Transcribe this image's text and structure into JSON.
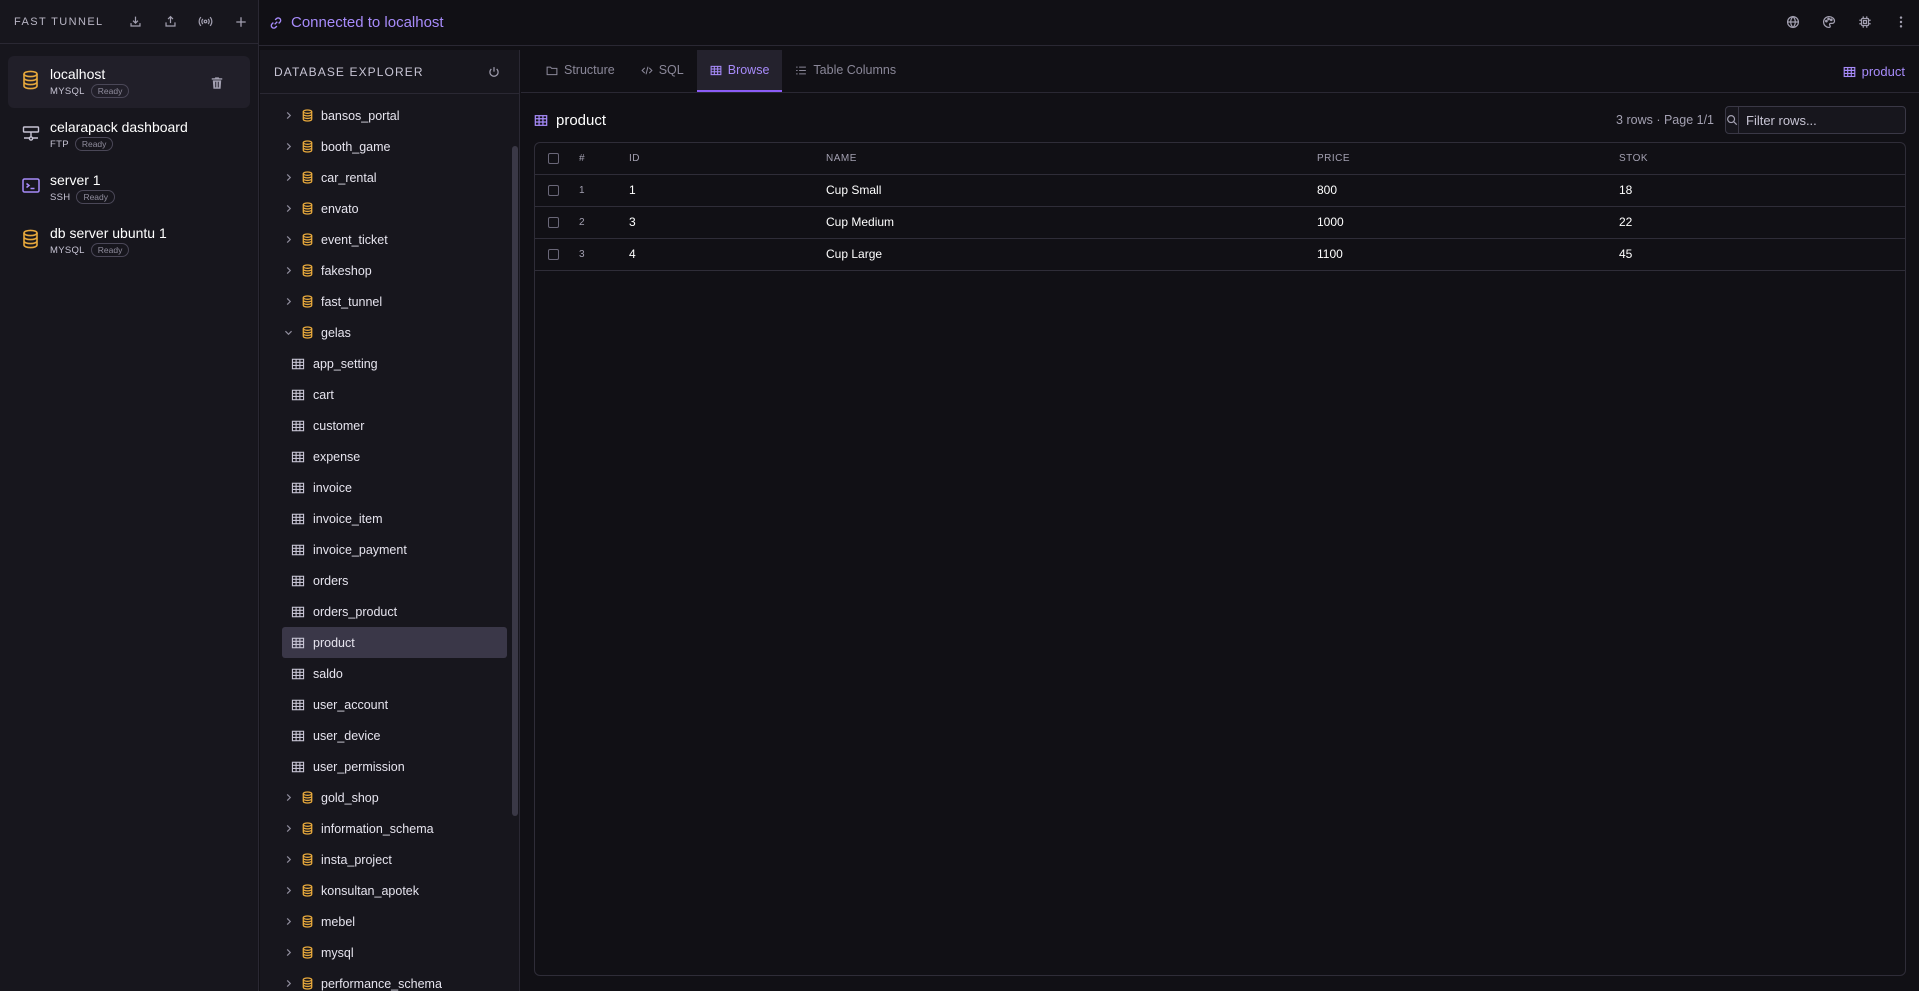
{
  "app": {
    "brand": "FAST TUNNEL",
    "connection_status": "Connected to localhost"
  },
  "connections": [
    {
      "name": "localhost",
      "type": "MYSQL",
      "status": "Ready",
      "icon": "database-icon"
    },
    {
      "name": "celarapack dashboard",
      "type": "FTP",
      "status": "Ready",
      "icon": "ftp-server-icon"
    },
    {
      "name": "server 1",
      "type": "SSH",
      "status": "Ready",
      "icon": "terminal-icon"
    },
    {
      "name": "db server ubuntu 1",
      "type": "MYSQL",
      "status": "Ready",
      "icon": "database-icon"
    }
  ],
  "explorer": {
    "title": "DATABASE EXPLORER",
    "databases_before": [
      "bansos_portal",
      "booth_game",
      "car_rental",
      "envato",
      "event_ticket",
      "fakeshop",
      "fast_tunnel"
    ],
    "expanded_db": "gelas",
    "tables": [
      "app_setting",
      "cart",
      "customer",
      "expense",
      "invoice",
      "invoice_item",
      "invoice_payment",
      "orders",
      "orders_product",
      "product",
      "saldo",
      "user_account",
      "user_device",
      "user_permission"
    ],
    "selected_table": "product",
    "databases_after": [
      "gold_shop",
      "information_schema",
      "insta_project",
      "konsultan_apotek",
      "mebel",
      "mysql",
      "performance_schema"
    ]
  },
  "tabs": [
    {
      "label": "Structure",
      "icon": "folder-icon"
    },
    {
      "label": "SQL",
      "icon": "code-icon"
    },
    {
      "label": "Browse",
      "icon": "table-icon",
      "active": true
    },
    {
      "label": "Table Columns",
      "icon": "list-icon"
    }
  ],
  "context_table": "product",
  "browse": {
    "title": "product",
    "row_info": "3 rows · Page 1/1",
    "filter_placeholder": "Filter rows...",
    "columns": [
      "#",
      "ID",
      "NAME",
      "PRICE",
      "STOK"
    ],
    "rows": [
      [
        "1",
        "1",
        "Cup Small",
        "800",
        "18"
      ],
      [
        "2",
        "3",
        "Cup Medium",
        "1000",
        "22"
      ],
      [
        "3",
        "4",
        "Cup Large",
        "1100",
        "45"
      ]
    ]
  },
  "colors": {
    "accent": "#a78bfa",
    "db_icon": "#e8a93c",
    "background": "#111015",
    "panel": "#17161d"
  }
}
